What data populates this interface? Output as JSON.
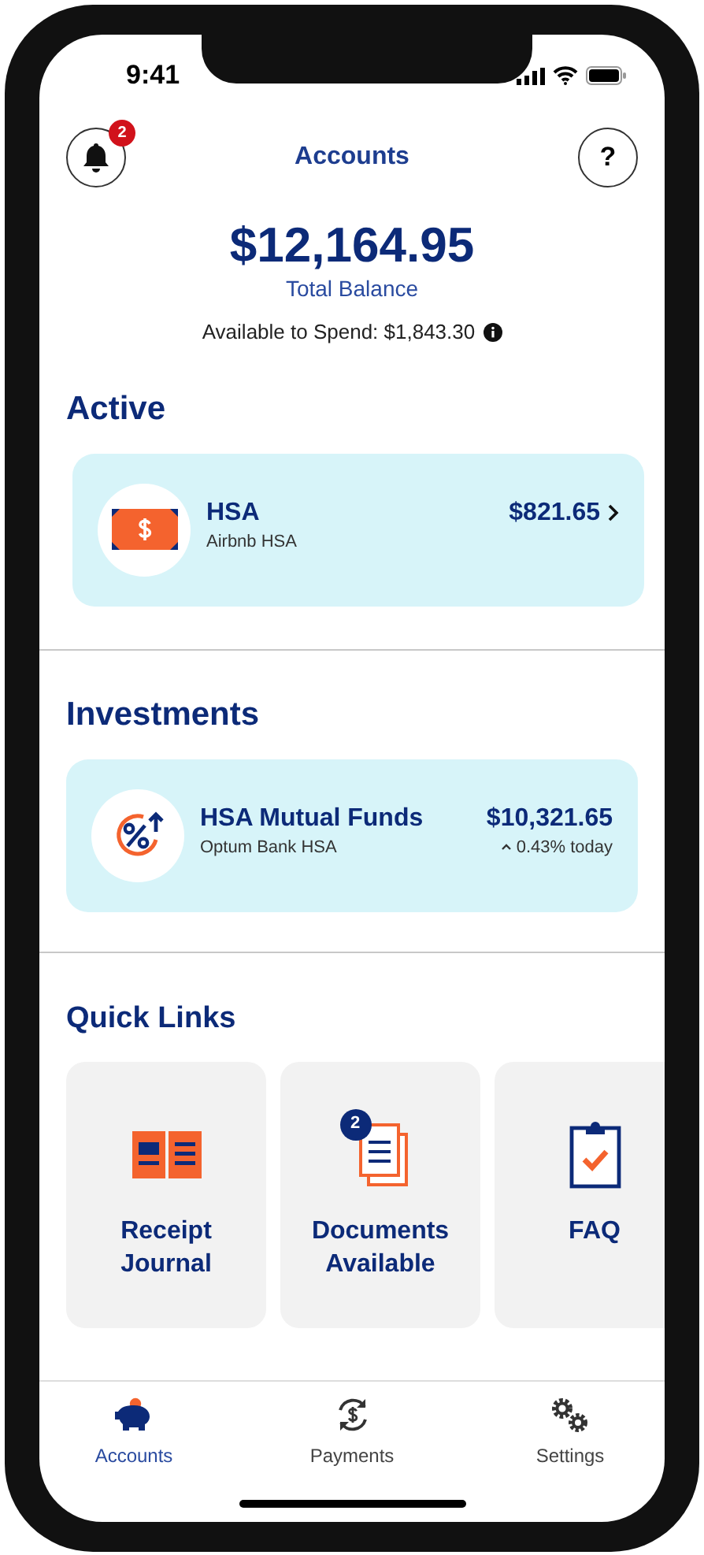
{
  "status_bar": {
    "time": "9:41"
  },
  "header": {
    "title": "Accounts",
    "notifications_badge": "2",
    "help": "?"
  },
  "balance": {
    "amount": "$12,164.95",
    "label": "Total Balance",
    "available": "Available to Spend: $1,843.30"
  },
  "sections": [
    {
      "title": "Active",
      "accounts": [
        {
          "kind": "cash",
          "name": "HSA",
          "provider": "Airbnb HSA",
          "amount": "$821.65",
          "chevron": true
        }
      ]
    },
    {
      "title": "Investments",
      "accounts": [
        {
          "kind": "invest",
          "name": "HSA Mutual Funds",
          "provider": "Optum Bank HSA",
          "amount": "$10,321.65",
          "change": "0.43% today",
          "chevron": false
        }
      ]
    }
  ],
  "quick_links": {
    "title": "Quick Links",
    "items": [
      {
        "kind": "journal",
        "label": "Receipt Journal"
      },
      {
        "kind": "documents",
        "label": "Documents Available",
        "badge": "2"
      },
      {
        "kind": "faq",
        "label": "FAQ"
      }
    ]
  },
  "tabs": [
    {
      "kind": "accounts",
      "label": "Accounts",
      "selected": true
    },
    {
      "kind": "payments",
      "label": "Payments",
      "selected": false
    },
    {
      "kind": "settings",
      "label": "Settings",
      "selected": false
    }
  ]
}
